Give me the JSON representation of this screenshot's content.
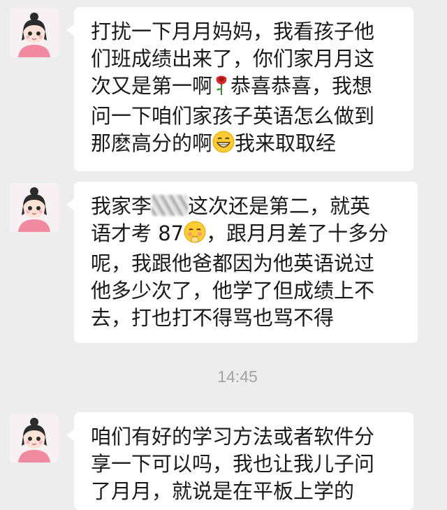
{
  "messages": [
    {
      "lines": [
        "打扰一下月月妈妈，我看孩子他",
        "们班成绩出来了，你们家月月这",
        "次又是第一啊",
        "恭喜恭喜，我想",
        "问一下咱们家孩子英语怎么做到",
        "那麽高分的啊",
        "我来取取经"
      ],
      "emojis": [
        "rose-icon",
        "grin-icon"
      ]
    },
    {
      "lines": [
        "我家李",
        "这次还是第二，就英",
        "语才考 87",
        "，跟月月差了十多分",
        "呢，我跟他爸都因为他英语说过",
        "他多少次了，他学了但成绩上不",
        "去，打也打不得骂也骂不得"
      ],
      "emojis": [
        "blush-icon"
      ]
    },
    {
      "lines": [
        "咱们有好的学习方法或者软件分",
        "享一下可以吗，我也让我儿子问",
        "了月月，就说是在平板上学的"
      ]
    }
  ],
  "timestamp": "14:45"
}
